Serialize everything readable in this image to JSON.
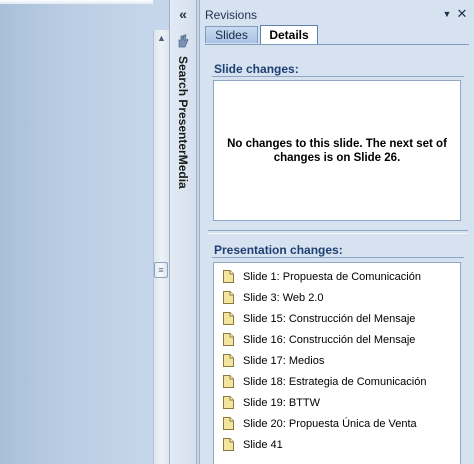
{
  "pane": {
    "title": "Revisions",
    "tabs": [
      {
        "label": "Slides",
        "selected": false
      },
      {
        "label": "Details",
        "selected": true
      }
    ]
  },
  "side_strip": {
    "label": "Search PresenterMedia"
  },
  "slide_changes": {
    "title": "Slide changes:",
    "message": "No changes to this slide.  The next set of changes is on Slide 26."
  },
  "presentation_changes": {
    "title": "Presentation changes:",
    "items": [
      {
        "label": "Slide 1: Propuesta de Comunicación"
      },
      {
        "label": "Slide 3: Web 2.0"
      },
      {
        "label": "Slide 15: Construcción del Mensaje"
      },
      {
        "label": "Slide 16: Construcción del Mensaje"
      },
      {
        "label": "Slide 17: Medios"
      },
      {
        "label": "Slide 18: Estrategia de Comunicación"
      },
      {
        "label": "Slide 19: BTTW"
      },
      {
        "label": "Slide 20: Propuesta Única de Venta"
      },
      {
        "label": "Slide 41"
      }
    ]
  },
  "colors": {
    "accent_title": "#1f3f73",
    "pane_bg": "#d6e2f0",
    "icon_yellow": "#e8d27a"
  }
}
